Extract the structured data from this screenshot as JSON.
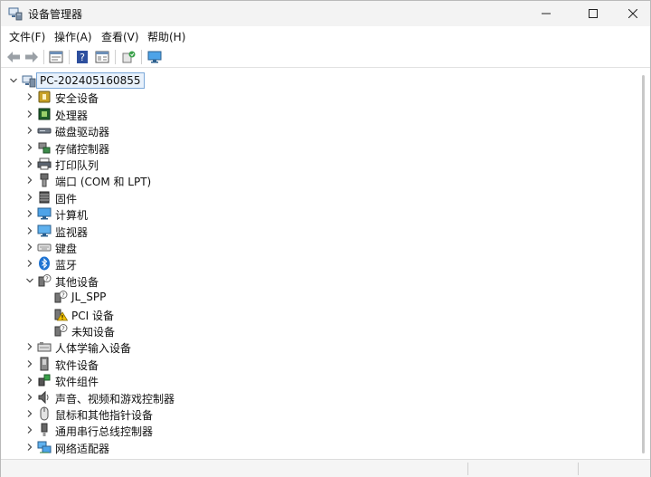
{
  "window": {
    "title": "设备管理器"
  },
  "menu": [
    {
      "label": "文件(F)"
    },
    {
      "label": "操作(A)"
    },
    {
      "label": "查看(V)"
    },
    {
      "label": "帮助(H)"
    }
  ],
  "toolbar": {
    "icons": [
      "back-arrow-icon",
      "forward-arrow-icon",
      "properties-icon",
      "help-icon",
      "view-icon",
      "update-driver-icon",
      "monitor-icon"
    ]
  },
  "tree": {
    "root": {
      "label": "PC-202405160855"
    },
    "items": [
      {
        "label": "安全设备",
        "icon": "security-device-icon",
        "expanded": false
      },
      {
        "label": "处理器",
        "icon": "processor-icon",
        "expanded": false
      },
      {
        "label": "磁盘驱动器",
        "icon": "disk-drive-icon",
        "expanded": false
      },
      {
        "label": "存储控制器",
        "icon": "storage-controller-icon",
        "expanded": false
      },
      {
        "label": "打印队列",
        "icon": "printer-icon",
        "expanded": false
      },
      {
        "label": "端口 (COM 和 LPT)",
        "icon": "port-icon",
        "expanded": false
      },
      {
        "label": "固件",
        "icon": "firmware-icon",
        "expanded": false
      },
      {
        "label": "计算机",
        "icon": "computer-icon",
        "expanded": false
      },
      {
        "label": "监视器",
        "icon": "monitor-icon",
        "expanded": false
      },
      {
        "label": "键盘",
        "icon": "keyboard-icon",
        "expanded": false
      },
      {
        "label": "蓝牙",
        "icon": "bluetooth-icon",
        "expanded": false
      },
      {
        "label": "其他设备",
        "icon": "unknown-device-icon",
        "expanded": true,
        "children": [
          {
            "label": "JL_SPP",
            "icon": "unknown-device-icon"
          },
          {
            "label": "PCI 设备",
            "icon": "warning-device-icon"
          },
          {
            "label": "未知设备",
            "icon": "unknown-device-icon"
          }
        ]
      },
      {
        "label": "人体学输入设备",
        "icon": "hid-icon",
        "expanded": false
      },
      {
        "label": "软件设备",
        "icon": "software-device-icon",
        "expanded": false
      },
      {
        "label": "软件组件",
        "icon": "software-component-icon",
        "expanded": false
      },
      {
        "label": "声音、视频和游戏控制器",
        "icon": "sound-icon",
        "expanded": false
      },
      {
        "label": "鼠标和其他指针设备",
        "icon": "mouse-icon",
        "expanded": false
      },
      {
        "label": "通用串行总线控制器",
        "icon": "usb-icon",
        "expanded": false
      },
      {
        "label": "网络适配器",
        "icon": "network-adapter-icon",
        "expanded": false
      }
    ]
  },
  "colors": {
    "accent": "#2f7de1",
    "warning": "#f2c200",
    "selection": "#e8f1fb"
  }
}
